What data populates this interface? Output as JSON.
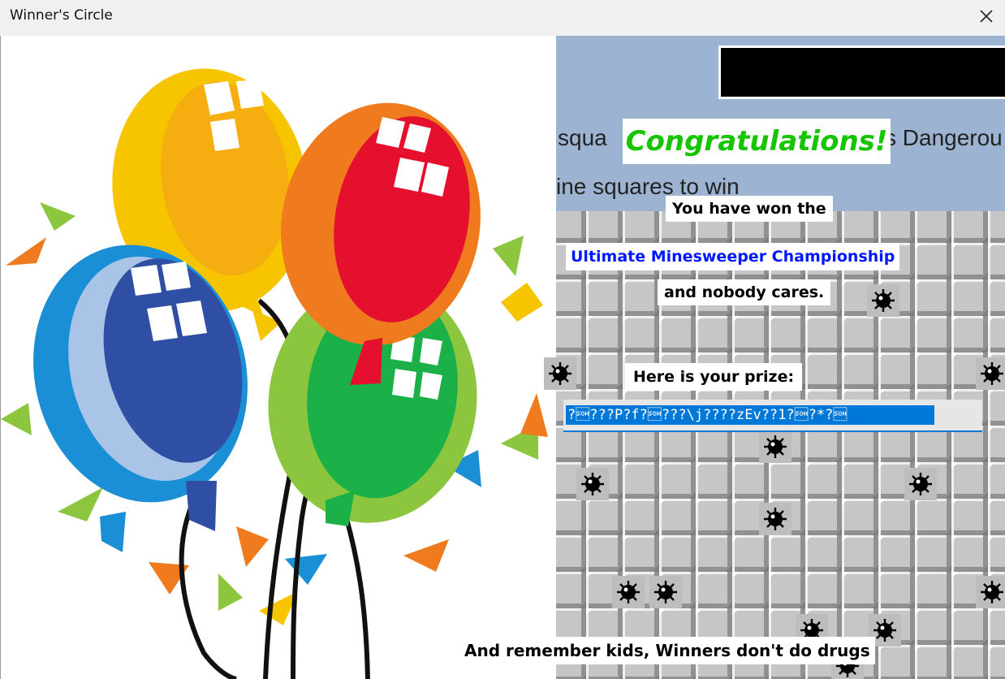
{
  "window": {
    "title": "Winner's Circle",
    "close_label": "✕"
  },
  "background": {
    "top_text_left": "squa",
    "top_text_right": "s Dangerou",
    "second_text": "ine squares to win"
  },
  "dialog": {
    "heading": "Congratulations!",
    "line1": "You have won the",
    "championship": "Ultimate Minesweeper Championship",
    "line3": "and nobody cares.",
    "prize_label": "Here is your prize:",
    "prize_value": "?\u0001???P?f?\u0001???\\j????zEv??1?\u0001?*?\u0001",
    "footer": "And remember kids, Winners don't do drugs"
  },
  "colors": {
    "heading": "#16c400",
    "championship": "#0018ff",
    "selection": "#0078d7",
    "sky": "#9cb4d2"
  }
}
